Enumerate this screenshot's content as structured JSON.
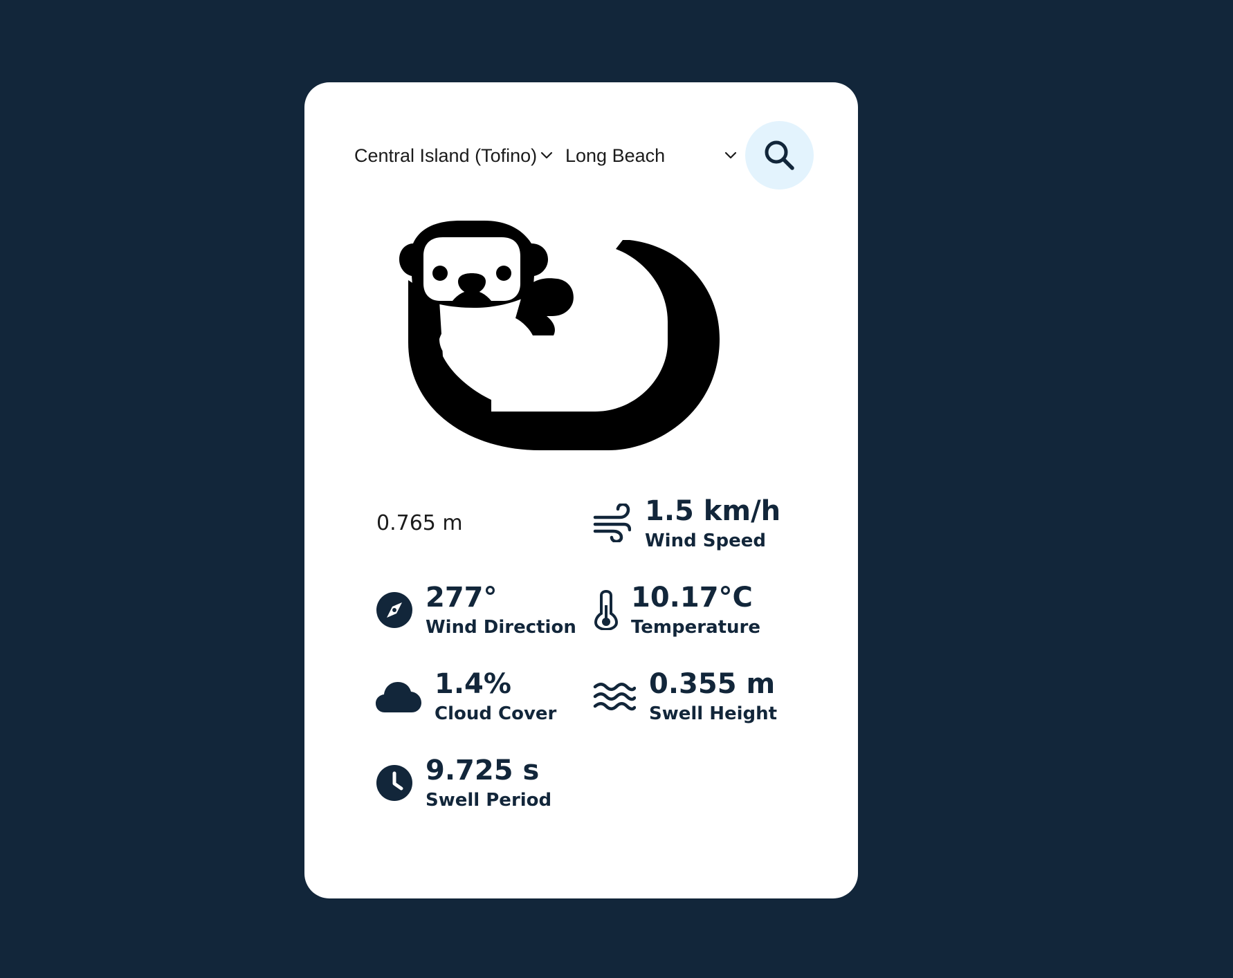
{
  "colors": {
    "page_background": "#12263a",
    "card_background": "#ffffff",
    "accent_text": "#12263a",
    "search_button_background": "#e3f3fd"
  },
  "filters": {
    "region": {
      "selected": "Central Island (Tofino)",
      "icon": "chevron-down-icon"
    },
    "beach": {
      "selected": "Long Beach",
      "icon": "chevron-down-icon"
    },
    "search_icon": "search-icon"
  },
  "hero": {
    "icon": "otter-icon"
  },
  "metrics": {
    "wave_height": {
      "value": "0.765 m"
    },
    "wind_speed": {
      "value": "1.5 km/h",
      "label": "Wind Speed",
      "icon": "wind-icon"
    },
    "wind_direction": {
      "value": "277°",
      "label": "Wind Direction",
      "icon": "compass-icon"
    },
    "temperature": {
      "value": "10.17°C",
      "label": "Temperature",
      "icon": "thermometer-icon"
    },
    "cloud_cover": {
      "value": "1.4%",
      "label": "Cloud Cover",
      "icon": "cloud-icon"
    },
    "swell_height": {
      "value": "0.355 m",
      "label": "Swell Height",
      "icon": "waves-icon"
    },
    "swell_period": {
      "value": "9.725 s",
      "label": "Swell Period",
      "icon": "clock-icon"
    }
  }
}
